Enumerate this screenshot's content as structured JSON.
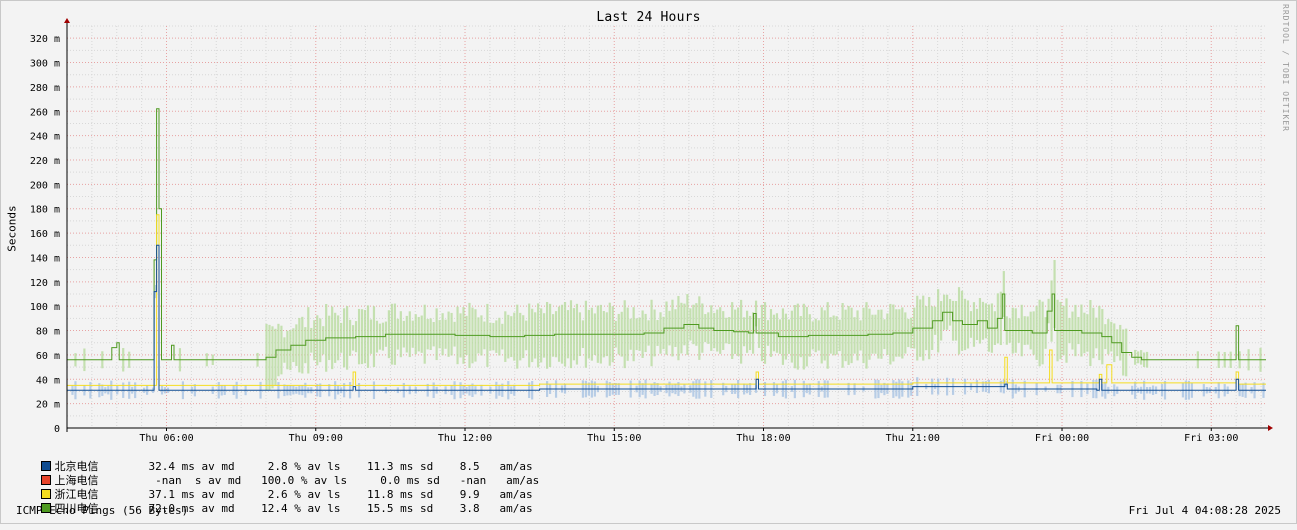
{
  "window_title": "Last 24 Hours",
  "watermark": "RRDTOOL / TOBI OETIKER",
  "legend": [
    {
      "name": "北京电信",
      "color": "#0f4c91",
      "stats": "32.4 ms av md     2.8 % av ls    11.3 ms sd    8.5   am/as"
    },
    {
      "name": "上海电信",
      "color": "#e8442a",
      "stats": " -nan  s av md   100.0 % av ls     0.0 ms sd   -nan   am/as"
    },
    {
      "name": "浙江电信",
      "color": "#f5dd20",
      "stats": "37.1 ms av md     2.6 % av ls    11.8 ms sd    9.9   am/as"
    },
    {
      "name": "四川电信",
      "color": "#4e9a20",
      "stats": "72.0 ms av md    12.4 % av ls    15.5 ms sd    3.8   am/as"
    }
  ],
  "footer": {
    "left": "ICMP Echo Pings (56 Bytes)",
    "right": "Fri Jul  4 04:08:28 2025"
  },
  "chart_data": {
    "type": "line",
    "title": "Last 24 Hours",
    "ylabel": "Seconds",
    "ylim": [
      0,
      0.33
    ],
    "y_ticks": [
      {
        "value": 0,
        "label": "0"
      },
      {
        "value": 0.02,
        "label": "20 m"
      },
      {
        "value": 0.04,
        "label": "40 m"
      },
      {
        "value": 0.06,
        "label": "60 m"
      },
      {
        "value": 0.08,
        "label": "80 m"
      },
      {
        "value": 0.1,
        "label": "100 m"
      },
      {
        "value": 0.12,
        "label": "120 m"
      },
      {
        "value": 0.14,
        "label": "140 m"
      },
      {
        "value": 0.16,
        "label": "160 m"
      },
      {
        "value": 0.18,
        "label": "180 m"
      },
      {
        "value": 0.2,
        "label": "200 m"
      },
      {
        "value": 0.22,
        "label": "220 m"
      },
      {
        "value": 0.24,
        "label": "240 m"
      },
      {
        "value": 0.26,
        "label": "260 m"
      },
      {
        "value": 0.28,
        "label": "280 m"
      },
      {
        "value": 0.3,
        "label": "300 m"
      },
      {
        "value": 0.32,
        "label": "320 m"
      }
    ],
    "xlim_hours": [
      4.0,
      28.1
    ],
    "x_ticks": [
      {
        "hour": 6,
        "label": "Thu 06:00"
      },
      {
        "hour": 9,
        "label": "Thu 09:00"
      },
      {
        "hour": 12,
        "label": "Thu 12:00"
      },
      {
        "hour": 15,
        "label": "Thu 15:00"
      },
      {
        "hour": 18,
        "label": "Thu 18:00"
      },
      {
        "hour": 21,
        "label": "Thu 21:00"
      },
      {
        "hour": 24,
        "label": "Fri 00:00"
      },
      {
        "hour": 27,
        "label": "Fri 03:00"
      }
    ],
    "grid": true,
    "series": [
      {
        "name": "四川电信",
        "color": "#4e9a20",
        "band_color": "#b9dca0",
        "points": [
          [
            4.0,
            0.056
          ],
          [
            4.8,
            0.056
          ],
          [
            4.9,
            0.066
          ],
          [
            5.0,
            0.07
          ],
          [
            5.05,
            0.056
          ],
          [
            5.6,
            0.056
          ],
          [
            5.75,
            0.138
          ],
          [
            5.8,
            0.262
          ],
          [
            5.85,
            0.18
          ],
          [
            5.9,
            0.056
          ],
          [
            6.0,
            0.056
          ],
          [
            6.1,
            0.068
          ],
          [
            6.15,
            0.056
          ],
          [
            7.0,
            0.056
          ],
          [
            7.8,
            0.056
          ],
          [
            8.0,
            0.058
          ],
          [
            8.2,
            0.064
          ],
          [
            8.5,
            0.068
          ],
          [
            8.8,
            0.072
          ],
          [
            9.2,
            0.074
          ],
          [
            9.8,
            0.075
          ],
          [
            10.4,
            0.077
          ],
          [
            11.0,
            0.077
          ],
          [
            11.8,
            0.076
          ],
          [
            12.5,
            0.075
          ],
          [
            13.2,
            0.076
          ],
          [
            13.8,
            0.077
          ],
          [
            14.4,
            0.077
          ],
          [
            15.0,
            0.077
          ],
          [
            15.6,
            0.078
          ],
          [
            16.0,
            0.082
          ],
          [
            16.4,
            0.085
          ],
          [
            16.7,
            0.082
          ],
          [
            17.0,
            0.08
          ],
          [
            17.4,
            0.079
          ],
          [
            17.7,
            0.078
          ],
          [
            17.8,
            0.094
          ],
          [
            17.85,
            0.078
          ],
          [
            18.3,
            0.075
          ],
          [
            18.9,
            0.076
          ],
          [
            19.5,
            0.076
          ],
          [
            20.1,
            0.077
          ],
          [
            20.6,
            0.078
          ],
          [
            21.0,
            0.082
          ],
          [
            21.4,
            0.088
          ],
          [
            21.6,
            0.095
          ],
          [
            21.8,
            0.088
          ],
          [
            22.0,
            0.085
          ],
          [
            22.3,
            0.088
          ],
          [
            22.5,
            0.082
          ],
          [
            22.7,
            0.09
          ],
          [
            22.8,
            0.11
          ],
          [
            22.85,
            0.08
          ],
          [
            23.4,
            0.078
          ],
          [
            23.6,
            0.078
          ],
          [
            23.7,
            0.096
          ],
          [
            23.8,
            0.11
          ],
          [
            23.85,
            0.08
          ],
          [
            24.4,
            0.078
          ],
          [
            24.8,
            0.075
          ],
          [
            25.0,
            0.07
          ],
          [
            25.2,
            0.062
          ],
          [
            25.4,
            0.058
          ],
          [
            25.6,
            0.056
          ],
          [
            26.5,
            0.056
          ],
          [
            27.4,
            0.056
          ],
          [
            27.5,
            0.084
          ],
          [
            27.55,
            0.056
          ],
          [
            28.1,
            0.056
          ]
        ]
      },
      {
        "name": "浙江电信",
        "color": "#f5dd20",
        "points": [
          [
            4.0,
            0.035
          ],
          [
            5.6,
            0.035
          ],
          [
            5.8,
            0.175
          ],
          [
            5.85,
            0.035
          ],
          [
            9.7,
            0.035
          ],
          [
            9.75,
            0.046
          ],
          [
            9.8,
            0.035
          ],
          [
            13.5,
            0.036
          ],
          [
            16.0,
            0.036
          ],
          [
            17.8,
            0.036
          ],
          [
            17.85,
            0.046
          ],
          [
            17.9,
            0.036
          ],
          [
            19.5,
            0.036
          ],
          [
            21.0,
            0.037
          ],
          [
            22.8,
            0.037
          ],
          [
            22.85,
            0.058
          ],
          [
            22.9,
            0.037
          ],
          [
            23.7,
            0.037
          ],
          [
            23.75,
            0.064
          ],
          [
            23.8,
            0.037
          ],
          [
            24.7,
            0.037
          ],
          [
            24.75,
            0.044
          ],
          [
            24.8,
            0.037
          ],
          [
            24.9,
            0.052
          ],
          [
            25.0,
            0.037
          ],
          [
            27.4,
            0.037
          ],
          [
            27.5,
            0.046
          ],
          [
            27.55,
            0.036
          ],
          [
            28.1,
            0.036
          ]
        ]
      },
      {
        "name": "北京电信",
        "color": "#0f4c91",
        "band_color": "#a9c4e4",
        "points": [
          [
            4.0,
            0.031
          ],
          [
            5.6,
            0.031
          ],
          [
            5.75,
            0.112
          ],
          [
            5.8,
            0.15
          ],
          [
            5.85,
            0.031
          ],
          [
            9.7,
            0.031
          ],
          [
            9.75,
            0.034
          ],
          [
            9.8,
            0.031
          ],
          [
            13.5,
            0.032
          ],
          [
            16.0,
            0.032
          ],
          [
            17.8,
            0.032
          ],
          [
            17.85,
            0.04
          ],
          [
            17.9,
            0.032
          ],
          [
            19.5,
            0.032
          ],
          [
            21.0,
            0.034
          ],
          [
            22.8,
            0.034
          ],
          [
            22.85,
            0.036
          ],
          [
            22.9,
            0.032
          ],
          [
            24.7,
            0.031
          ],
          [
            24.75,
            0.04
          ],
          [
            24.8,
            0.031
          ],
          [
            27.4,
            0.031
          ],
          [
            27.5,
            0.04
          ],
          [
            27.55,
            0.031
          ],
          [
            28.1,
            0.031
          ]
        ]
      }
    ]
  }
}
